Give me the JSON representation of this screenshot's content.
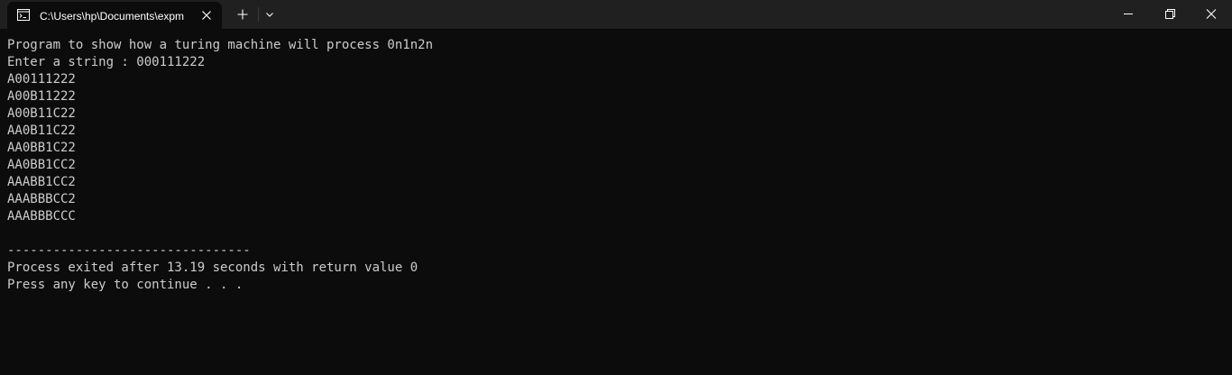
{
  "tab": {
    "title": "C:\\Users\\hp\\Documents\\expm",
    "icon": "console-icon"
  },
  "titlebar": {
    "new_tab_icon": "plus-icon",
    "dropdown_icon": "chevron-down-icon",
    "minimize_icon": "minimize-icon",
    "maximize_icon": "restore-icon",
    "close_icon": "close-icon"
  },
  "colors": {
    "titlebar_bg": "#202020",
    "console_bg": "#0c0c0c",
    "text": "#cccccc"
  },
  "console": {
    "lines": [
      "Program to show how a turing machine will process 0n1n2n",
      "Enter a string : 000111222",
      "A00111222",
      "A00B11222",
      "A00B11C22",
      "AA0B11C22",
      "AA0BB1C22",
      "AA0BB1CC2",
      "AAABB1CC2",
      "AAABBBCC2",
      "AAABBBCCC",
      "",
      "--------------------------------",
      "Process exited after 13.19 seconds with return value 0",
      "Press any key to continue . . ."
    ]
  }
}
